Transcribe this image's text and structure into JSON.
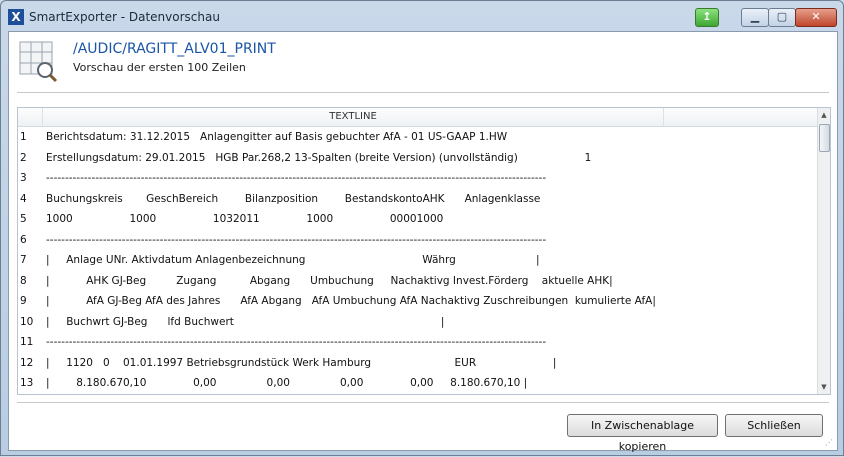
{
  "window": {
    "title": "SmartExporter - Datenvorschau",
    "app_icon_glyph": "X"
  },
  "titlebar_buttons": {
    "min_glyph": "▁",
    "max_glyph": "▢",
    "close_glyph": "✕",
    "green_glyph": "↥"
  },
  "header": {
    "title": "/AUDIC/RAGITT_ALV01_PRINT",
    "subtitle": "Vorschau der ersten 100 Zeilen"
  },
  "grid": {
    "column_header": "TEXTLINE",
    "rows": [
      {
        "n": "1",
        "text": "Berichtsdatum: 31.12.2015   Anlagengitter auf Basis gebuchter AfA - 01 US-GAAP 1.HW"
      },
      {
        "n": "2",
        "text": "Erstellungsdatum: 29.01.2015   HGB Par.268,2 13-Spalten (breite Version) (unvollständig)                    1"
      },
      {
        "n": "3",
        "text": "------------------------------------------------------------------------------------------------------------------------------------"
      },
      {
        "n": "4",
        "text": "Buchungskreis       GeschBereich        Bilanzposition        BestandskontoAHK      Anlagenklasse"
      },
      {
        "n": "5",
        "text": "1000                 1000                 1032011              1000                 00001000"
      },
      {
        "n": "6",
        "text": "------------------------------------------------------------------------------------------------------------------------------------"
      },
      {
        "n": "7",
        "text": "|     Anlage UNr. Aktivdatum Anlagenbezeichnung                                   Währg                        |"
      },
      {
        "n": "8",
        "text": "|           AHK GJ-Beg         Zugang          Abgang      Umbuchung     Nachaktivg Invest.Förderg    aktuelle AHK|"
      },
      {
        "n": "9",
        "text": "|           AfA GJ-Beg AfA des Jahres      AfA Abgang   AfA Umbuchung AfA Nachaktivg Zuschreibungen  kumulierte AfA|"
      },
      {
        "n": "10",
        "text": "|     Buchwrt GJ-Beg      lfd Buchwert                                                              |"
      },
      {
        "n": "11",
        "text": "------------------------------------------------------------------------------------------------------------------------------------"
      },
      {
        "n": "12",
        "text": "|     1120   0    01.01.1997 Betriebsgrundstück Werk Hamburg                         EUR                       |"
      },
      {
        "n": "13",
        "text": "|        8.180.670,10              0,00               0,00               0,00              0,00     8.180.670,10 |"
      }
    ]
  },
  "buttons": {
    "copy": "In Zwischenablage kopieren",
    "close": "Schließen"
  }
}
